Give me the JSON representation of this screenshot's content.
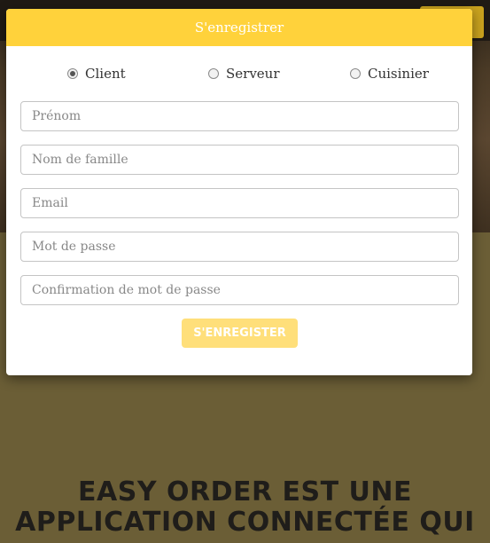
{
  "modal": {
    "title": "S'enregistrer",
    "roles": [
      {
        "label": "Client",
        "checked": true
      },
      {
        "label": "Serveur",
        "checked": false
      },
      {
        "label": "Cuisinier",
        "checked": false
      }
    ],
    "fields": {
      "first_name": {
        "placeholder": "Prénom",
        "value": ""
      },
      "last_name": {
        "placeholder": "Nom de famille",
        "value": ""
      },
      "email": {
        "placeholder": "Email",
        "value": ""
      },
      "password": {
        "placeholder": "Mot de passe",
        "value": ""
      },
      "password_confirm": {
        "placeholder": "Confirmation de mot de passe",
        "value": ""
      }
    },
    "submit_label": "S'ENREGISTER"
  },
  "hero": {
    "title_line1": "EASY ORDER EST UNE",
    "title_line2": "APPLICATION CONNECTÉE QUI"
  },
  "colors": {
    "accent": "#ffd23b",
    "button_disabled": "#ffdf7a",
    "backdrop": "#6b5e36"
  }
}
